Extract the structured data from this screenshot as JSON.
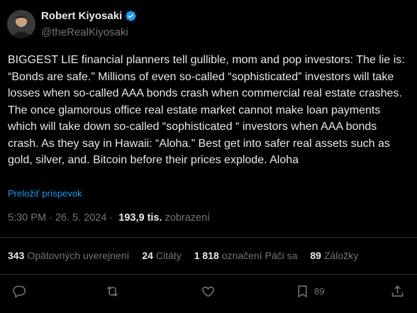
{
  "author": {
    "display_name": "Robert Kiyosaki",
    "handle": "@theRealKiyosaki"
  },
  "tweet": {
    "text": "BIGGEST LIE financial planners tell gullible, mom and pop investors:  The lie is: “Bonds are safe.”  Millions of even so-called “sophisticated” investors will take losses when so-called AAA bonds crash when commercial real estate crashes. The once glamorous office real estate market cannot make loan payments which will take down so-called “sophisticated “ investors when AAA bonds crash. As they say in Hawaii: “Aloha.”  Best get into safer real assets such as gold, silver, and. Bitcoin before their prices explode.  Aloha",
    "translate_label": "Preložiť príspevok"
  },
  "meta": {
    "time": "5:30 PM",
    "separator": "·",
    "date": "26. 5. 2024",
    "views_count": "193,9 tis.",
    "views_label": "zobrazení"
  },
  "stats": {
    "reposts": {
      "count": "343",
      "label": "Opätovných uverejnení"
    },
    "quotes": {
      "count": "24",
      "label": "Citáty"
    },
    "likes": {
      "count": "1 818",
      "label": "označení Páči sa"
    },
    "bookmarks": {
      "count": "89",
      "label": "Záložky"
    }
  },
  "actions": {
    "bookmark_count": "89"
  },
  "icons": {
    "verified": "verified-badge-icon",
    "reply": "reply-icon",
    "repost": "repost-icon",
    "like": "heart-icon",
    "bookmark": "bookmark-icon",
    "share": "share-icon"
  },
  "colors": {
    "background": "#000000",
    "text": "#e7e9ea",
    "secondary": "#71767b",
    "accent": "#1d9bf0",
    "divider": "#2f3336"
  }
}
